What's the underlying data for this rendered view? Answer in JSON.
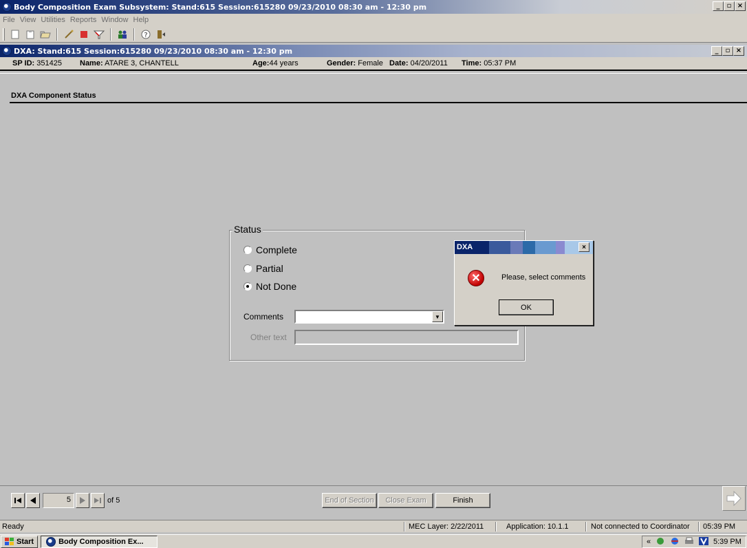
{
  "app": {
    "title": "Body Composition Exam Subsystem: Stand:615 Session:615280 09/23/2010 08:30 am - 12:30 pm",
    "window_buttons": [
      "_",
      "▫",
      "×"
    ]
  },
  "menu": [
    "File",
    "View",
    "Utilities",
    "Reports",
    "Window",
    "Help"
  ],
  "toolbar": {
    "icons": [
      "new-icon",
      "clipboard-icon",
      "open-icon",
      "edit-icon",
      "stop-icon",
      "filter-icon",
      "people-icon",
      "help-icon",
      "exit-icon"
    ]
  },
  "child_window": {
    "title": "DXA: Stand:615 Session:615280 09/23/2010 08:30 am - 12:30 pm"
  },
  "patient": {
    "sp_id_label": "SP ID:",
    "sp_id": "351425",
    "name_label": "Name:",
    "name": "ATARE 3, CHANTELL",
    "age_label": "Age:",
    "age": "44 years",
    "gender_label": "Gender:",
    "gender": "Female",
    "date_label": "Date:",
    "date": "04/20/2011",
    "time_label": "Time:",
    "time": "05:37 PM"
  },
  "section": {
    "header": "DXA Component Status"
  },
  "status_group": {
    "legend": "Status",
    "options": [
      {
        "label": "Complete",
        "selected": false
      },
      {
        "label": "Partial",
        "selected": false
      },
      {
        "label": "Not Done",
        "selected": true
      }
    ],
    "comments_label": "Comments",
    "comments_value": "",
    "other_text_label": "Other text",
    "other_text_value": ""
  },
  "dialog": {
    "title": "DXA",
    "message": "Please, select comments",
    "ok_label": "OK",
    "close_label": "×"
  },
  "navigation": {
    "current_page": "5",
    "of_label": "of 5",
    "end_of_section_label": "End of Section",
    "close_exam_label": "Close Exam",
    "finish_label": "Finish"
  },
  "statusbar": {
    "ready": "Ready",
    "mec_layer": "MEC Layer: 2/22/2011",
    "application": "Application: 10.1.1",
    "coordinator": "Not connected to Coordinator",
    "time": "05:39 PM"
  },
  "taskbar": {
    "start_label": "Start",
    "task_label": "Body Composition Ex...",
    "tray_chevron": "«",
    "clock": "5:39 PM"
  },
  "colors": {
    "title_active": "#0a246a",
    "face": "#d4d0c8",
    "workspace": "#c0c0c0",
    "error_red": "#c00000"
  }
}
